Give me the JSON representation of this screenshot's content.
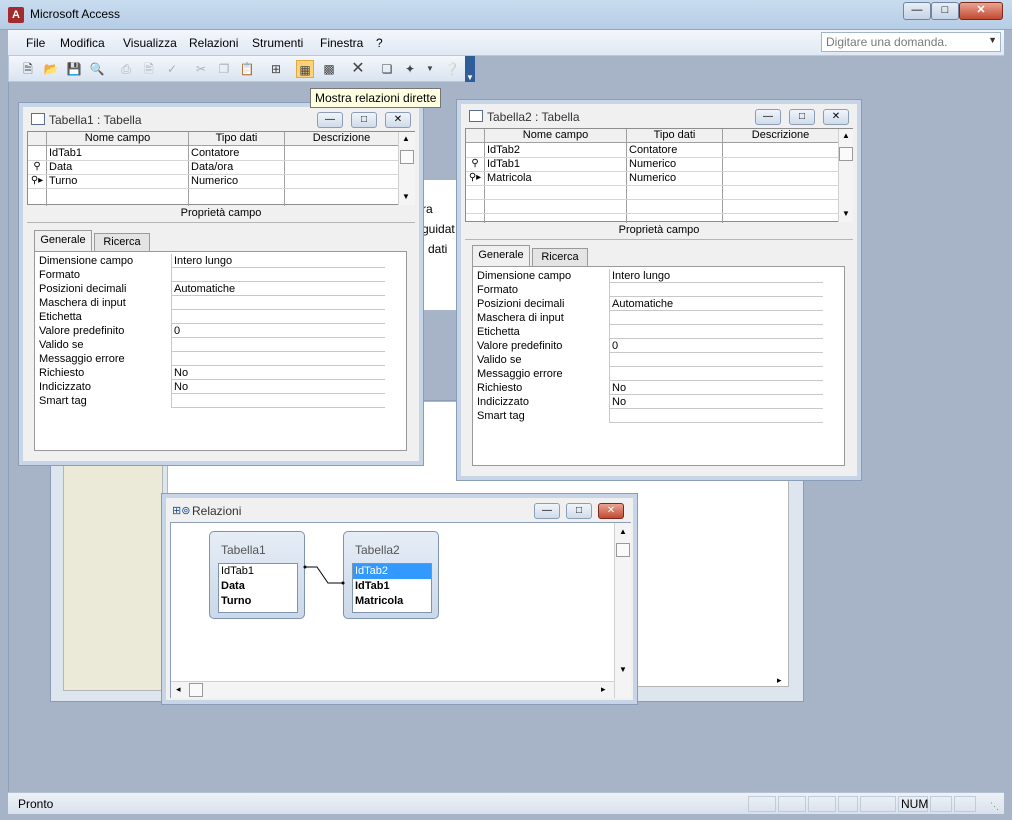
{
  "app": {
    "title": "Microsoft Access",
    "icon": "access-icon"
  },
  "menu": {
    "items": [
      "File",
      "Modifica",
      "Visualizza",
      "Relazioni",
      "Strumenti",
      "Finestra",
      "?"
    ]
  },
  "help_box": {
    "placeholder": "Digitare una domanda."
  },
  "tooltip": "Mostra relazioni dirette",
  "status": {
    "text": "Pronto",
    "num": "NUM"
  },
  "bg_window": {
    "lines": [
      "ra",
      "guidat",
      "i dati"
    ]
  },
  "tab1": {
    "title": "Tabella1 : Tabella",
    "headers": [
      "Nome campo",
      "Tipo dati",
      "Descrizione"
    ],
    "rows": [
      {
        "name": "IdTab1",
        "type": "Contatore",
        "marker": ""
      },
      {
        "name": "Data",
        "type": "Data/ora",
        "marker": "key"
      },
      {
        "name": "Turno",
        "type": "Numerico",
        "marker": "key-current"
      }
    ],
    "props_caption": "Proprietà campo",
    "tabs": [
      "Generale",
      "Ricerca"
    ],
    "props": [
      [
        "Dimensione campo",
        "Intero lungo"
      ],
      [
        "Formato",
        ""
      ],
      [
        "Posizioni decimali",
        "Automatiche"
      ],
      [
        "Maschera di input",
        ""
      ],
      [
        "Etichetta",
        ""
      ],
      [
        "Valore predefinito",
        "0"
      ],
      [
        "Valido se",
        ""
      ],
      [
        "Messaggio errore",
        ""
      ],
      [
        "Richiesto",
        "No"
      ],
      [
        "Indicizzato",
        "No"
      ],
      [
        "Smart tag",
        ""
      ]
    ]
  },
  "tab2": {
    "title": "Tabella2 : Tabella",
    "headers": [
      "Nome campo",
      "Tipo dati",
      "Descrizione"
    ],
    "rows": [
      {
        "name": "IdTab2",
        "type": "Contatore",
        "marker": ""
      },
      {
        "name": "IdTab1",
        "type": "Numerico",
        "marker": "key"
      },
      {
        "name": "Matricola",
        "type": "Numerico",
        "marker": "key-current"
      }
    ],
    "props_caption": "Proprietà campo",
    "tabs": [
      "Generale",
      "Ricerca"
    ],
    "props": [
      [
        "Dimensione campo",
        "Intero lungo"
      ],
      [
        "Formato",
        ""
      ],
      [
        "Posizioni decimali",
        "Automatiche"
      ],
      [
        "Maschera di input",
        ""
      ],
      [
        "Etichetta",
        ""
      ],
      [
        "Valore predefinito",
        "0"
      ],
      [
        "Valido se",
        ""
      ],
      [
        "Messaggio errore",
        ""
      ],
      [
        "Richiesto",
        "No"
      ],
      [
        "Indicizzato",
        "No"
      ],
      [
        "Smart tag",
        ""
      ]
    ]
  },
  "rel": {
    "title": "Relazioni",
    "tables": [
      {
        "name": "Tabella1",
        "fields": [
          {
            "label": "IdTab1",
            "bold": false,
            "selected": false
          },
          {
            "label": "Data",
            "bold": true,
            "selected": false
          },
          {
            "label": "Turno",
            "bold": true,
            "selected": false
          }
        ]
      },
      {
        "name": "Tabella2",
        "fields": [
          {
            "label": "IdTab2",
            "bold": false,
            "selected": true
          },
          {
            "label": "IdTab1",
            "bold": true,
            "selected": false
          },
          {
            "label": "Matricola",
            "bold": true,
            "selected": false
          }
        ]
      }
    ]
  }
}
